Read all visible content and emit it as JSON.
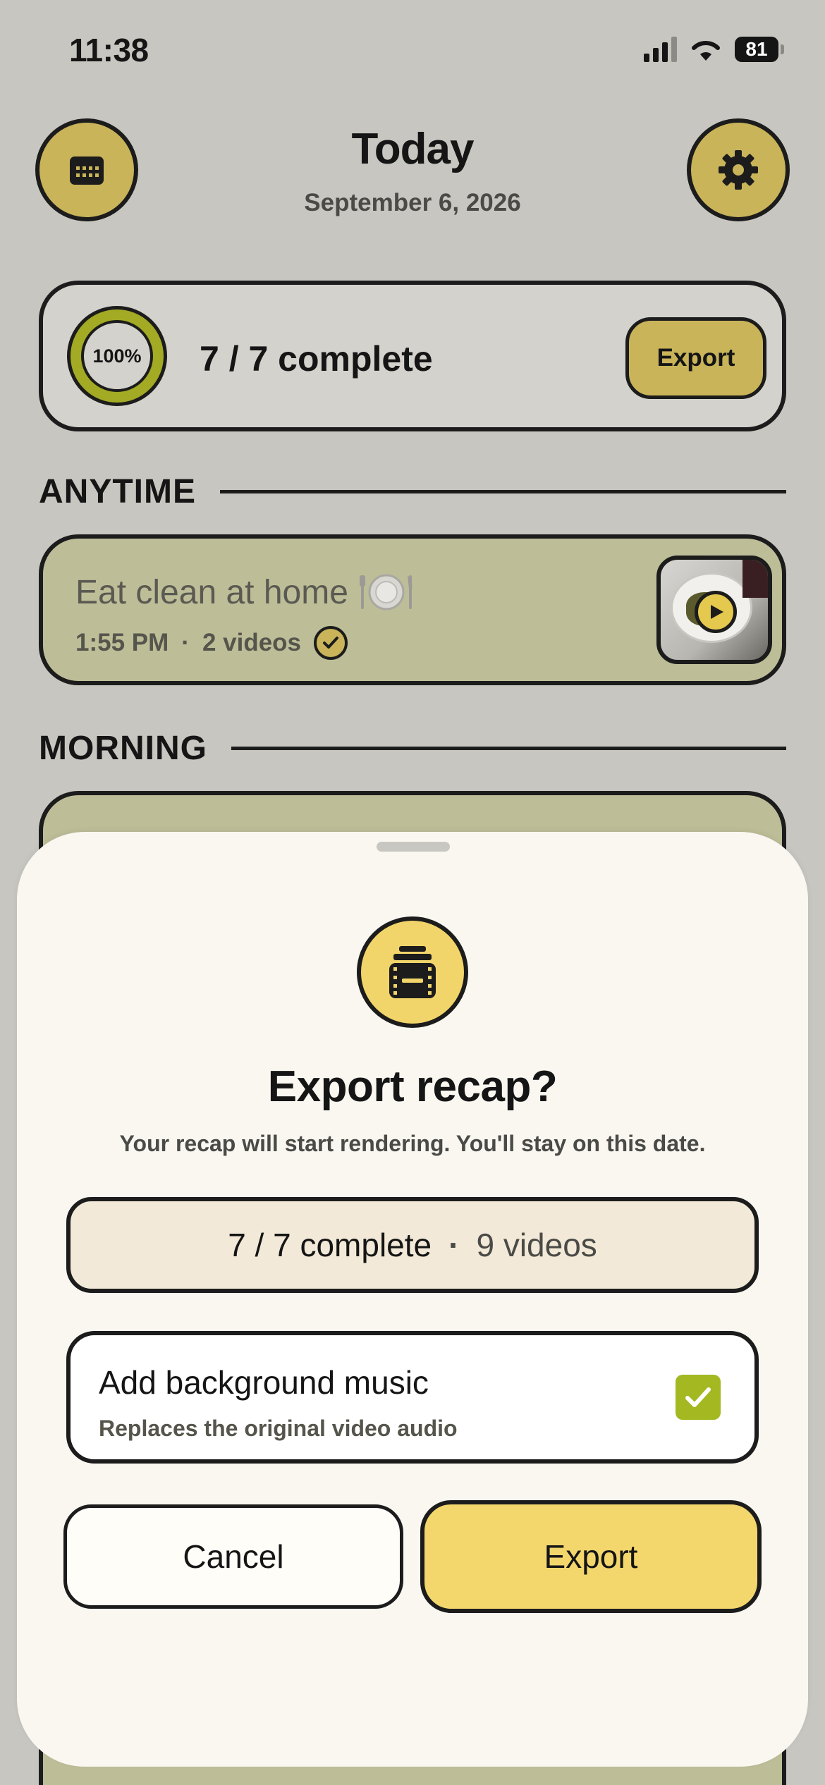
{
  "status_bar": {
    "time": "11:38",
    "battery": "81"
  },
  "header": {
    "title": "Today",
    "date": "September 6, 2026"
  },
  "progress": {
    "percent_label": "100%",
    "percent": 100,
    "summary": "7 / 7 complete",
    "export_label": "Export"
  },
  "sections": [
    {
      "label": "ANYTIME"
    },
    {
      "label": "MORNING"
    }
  ],
  "tasks": [
    {
      "title": "Eat clean at home",
      "time": "1:55 PM",
      "separator": "·",
      "videos": "2 videos",
      "completed": true
    }
  ],
  "sheet": {
    "title": "Export recap?",
    "subtitle": "Your recap will start rendering. You'll stay on this date.",
    "summary_complete": "7 / 7 complete",
    "summary_separator": "·",
    "summary_videos": "9 videos",
    "music_title": "Add background music",
    "music_subtitle": "Replaces the original video audio",
    "music_checked": true,
    "cancel_label": "Cancel",
    "export_label": "Export"
  },
  "colors": {
    "background": "#c8c6c0",
    "accent": "#c9b45a",
    "accent_bright": "#f3d76d",
    "card": "#bdbe98",
    "ring_green": "#a3aa24",
    "check_green": "#a4b821",
    "sheet": "#faf7f1"
  },
  "icons": {
    "calendar_button": "calendar-icon",
    "settings_button": "gear-icon",
    "task_emoji": "plate-utensils-icon",
    "sheet": "film-stack-icon"
  }
}
